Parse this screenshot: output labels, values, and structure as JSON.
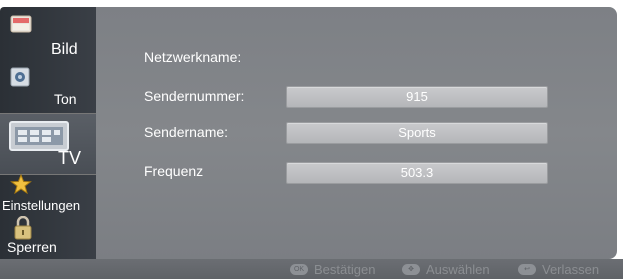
{
  "sidebar": {
    "items": [
      {
        "label": "Bild",
        "icon": "picture-icon"
      },
      {
        "label": "Ton",
        "icon": "speaker-icon"
      },
      {
        "label": "TV",
        "icon": "tv-channel-icon",
        "active": true
      },
      {
        "label": "Einstellungen",
        "icon": "star-settings-icon"
      },
      {
        "label": "Sperren",
        "icon": "lock-icon"
      }
    ]
  },
  "main": {
    "rows": [
      {
        "label": "Netzwerkname:",
        "value": ""
      },
      {
        "label": "Sendernummer:",
        "value": "915"
      },
      {
        "label": "Sendername:",
        "value": "Sports"
      },
      {
        "label": "Frequenz",
        "value": "503.3"
      }
    ]
  },
  "footer": {
    "confirm_label": "Bestätigen",
    "select_label": "Auswählen",
    "exit_label": "Verlassen"
  }
}
